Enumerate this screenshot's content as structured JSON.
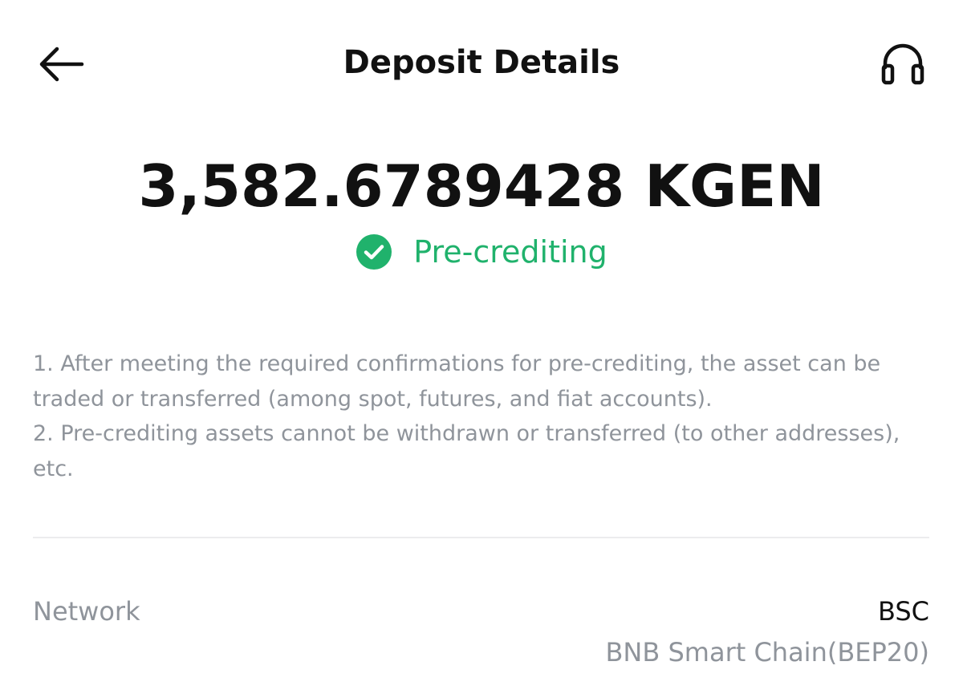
{
  "header": {
    "title": "Deposit Details",
    "back_icon": "arrow-left-icon",
    "support_icon": "headphones-icon"
  },
  "deposit": {
    "amount": "3,582.6789428 KGEN",
    "status": "Pre-crediting",
    "status_icon": "check-circle-icon",
    "status_color": "#20b26c"
  },
  "notes": [
    "1. After meeting the required confirmations for pre-crediting, the asset can be traded or transferred (among spot, futures, and fiat accounts).",
    "2. Pre-crediting assets cannot be withdrawn or transferred (to other addresses), etc."
  ],
  "details": {
    "network_label": "Network",
    "network_value": "BSC",
    "network_full_name": "BNB Smart Chain(BEP20)"
  }
}
